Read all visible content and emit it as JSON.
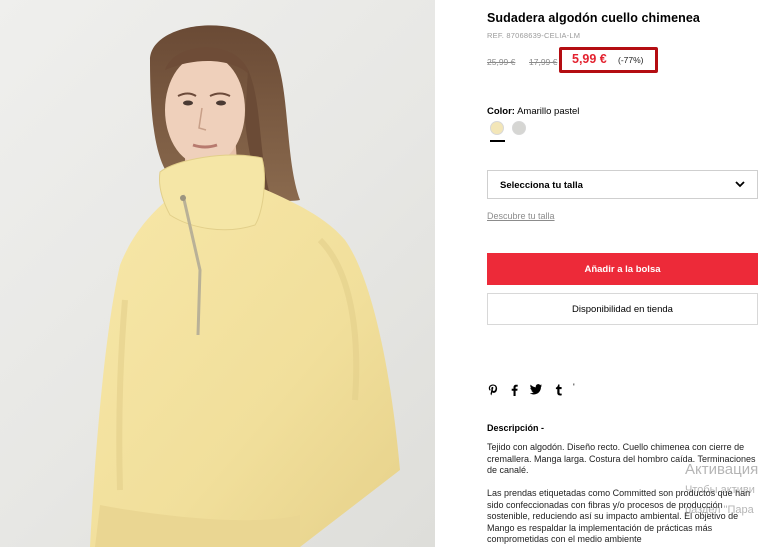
{
  "product": {
    "title": "Sudadera algodón cuello chimenea",
    "ref": "REF. 87068639-CELIA-LM",
    "old_price_1": "25,99 €",
    "old_price_2": "17,99 €",
    "price": "5,99 €",
    "discount": "(-77%)",
    "color_label": "Color:",
    "color_value": "Amarillo pastel",
    "swatches": [
      {
        "name": "Amarillo pastel",
        "color": "#f3e6b8"
      },
      {
        "name": "Gris",
        "color": "#d6d6d3"
      }
    ]
  },
  "size": {
    "select_label": "Selecciona tu talla",
    "guide_link": "Descubre tu talla"
  },
  "actions": {
    "add_to_bag": "Añadir a la bolsa",
    "store_availability": "Disponibilidad en tienda"
  },
  "share": {
    "icons": [
      "pinterest-icon",
      "facebook-icon",
      "twitter-icon",
      "tumblr-icon"
    ],
    "more": "'"
  },
  "description": {
    "heading": "Descripción  -",
    "paragraph_1": "Tejido con algodón. Diseño recto. Cuello chimenea con cierre de cremallera. Manga larga. Costura del hombro caída. Terminaciones de canalé.",
    "paragraph_2": "Las prendas etiquetadas como Committed son productos que han sido confeccionadas con fibras y/o procesos de producción sostenible, reduciendo así su impacto ambiental. El objetivo de Mango es respaldar la implementación de prácticas más comprometidas con el medio ambiente"
  },
  "watermark": {
    "line_1": "Активация",
    "line_2": "Чтобы активи",
    "line_3": "раздел \"Пара"
  },
  "colors": {
    "accent_red": "#ed2a39",
    "price_red": "#e3222f",
    "highlight_box": "#b40d12",
    "sweater_yellow": "#f3e6b8"
  }
}
